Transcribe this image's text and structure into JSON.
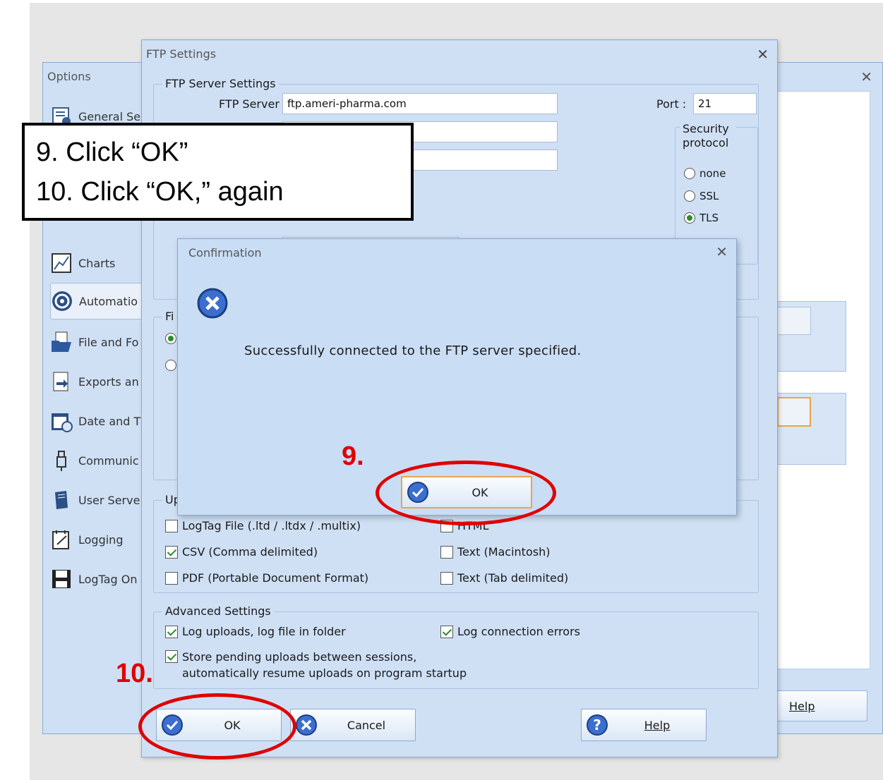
{
  "options_window": {
    "title": "Options",
    "nav": [
      {
        "label": "General Se",
        "icon": "general-settings-icon"
      },
      {
        "label": "Charts",
        "icon": "charts-icon"
      },
      {
        "label": "Automatio",
        "icon": "automation-icon",
        "active": true
      },
      {
        "label": "File and Fo",
        "icon": "file-folder-icon"
      },
      {
        "label": "Exports an",
        "icon": "exports-icon"
      },
      {
        "label": "Date and T",
        "icon": "date-time-icon"
      },
      {
        "label": "Communic",
        "icon": "communication-icon"
      },
      {
        "label": "User Serve",
        "icon": "user-server-icon"
      },
      {
        "label": "Logging",
        "icon": "logging-icon"
      },
      {
        "label": "LogTag On",
        "icon": "logtag-online-icon"
      }
    ],
    "help_label": "Help"
  },
  "ftp_window": {
    "title": "FTP Settings",
    "server_group_legend": "FTP Server Settings",
    "server_label": "FTP Server",
    "server_value": "ftp.ameri-pharma.com",
    "port_label": "Port :",
    "port_value": "21",
    "security_legend": "Security protocol",
    "security_options": [
      {
        "label": "none",
        "selected": false
      },
      {
        "label": "SSL",
        "selected": false
      },
      {
        "label": "TLS",
        "selected": true
      }
    ],
    "file_group_legend_partial": "Fi",
    "upload_group_legend_partial": "Up",
    "file_types": [
      {
        "label": "LogTag File (.ltd / .ltdx / .multix)",
        "checked": false
      },
      {
        "label": "HTML",
        "checked": false
      },
      {
        "label": "CSV (Comma delimited)",
        "checked": true
      },
      {
        "label": "Text (Macintosh)",
        "checked": false
      },
      {
        "label": "PDF (Portable Document Format)",
        "checked": false
      },
      {
        "label": "Text (Tab delimited)",
        "checked": false
      }
    ],
    "advanced_legend": "Advanced Settings",
    "advanced": [
      {
        "label": "Log uploads, log file in folder",
        "checked": true
      },
      {
        "label": "Log connection errors",
        "checked": true
      },
      {
        "label": "Store pending uploads between sessions,",
        "label2": "automatically resume uploads on program startup",
        "checked": true
      }
    ],
    "ok_label": "OK",
    "cancel_label": "Cancel",
    "help_label": "Help"
  },
  "confirmation": {
    "title": "Confirmation",
    "message": "Successfully connected to the FTP server specified.",
    "ok_label": "OK"
  },
  "annotations": {
    "callout_line1": "9. Click “OK”",
    "callout_line2": "10. Click “OK,” again",
    "step9": "9.",
    "step10": "10.",
    "color": "#e00000"
  }
}
